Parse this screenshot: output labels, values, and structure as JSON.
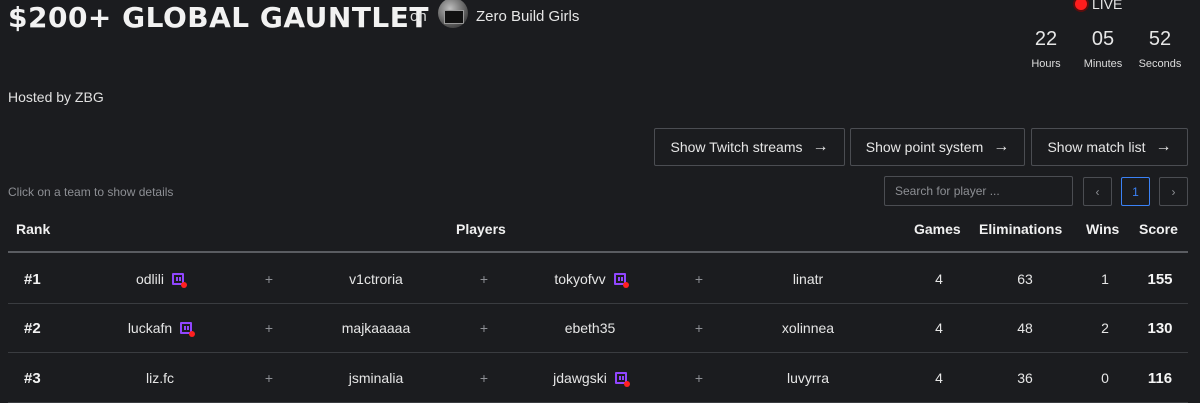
{
  "header": {
    "title": "$200+ GLOBAL GAUNTLET",
    "on_label": "on",
    "org_name": "Zero Build Girls",
    "hosted_by": "Hosted by ZBG"
  },
  "status": {
    "live_label": "LIVE",
    "live_color": "#ff1d1d"
  },
  "countdown": {
    "hours": "22",
    "hours_label": "Hours",
    "minutes": "05",
    "minutes_label": "Minutes",
    "seconds": "52",
    "seconds_label": "Seconds"
  },
  "actions": {
    "twitch_streams": "Show Twitch streams",
    "point_system": "Show point system",
    "match_list": "Show match list",
    "arrow": "→"
  },
  "table_controls": {
    "hint": "Click on a team to show details",
    "search_placeholder": "Search for player ...",
    "pagination": {
      "prev": "‹",
      "current": "1",
      "next": "›"
    }
  },
  "table": {
    "headers": {
      "rank": "Rank",
      "players": "Players",
      "games": "Games",
      "eliminations": "Eliminations",
      "wins": "Wins",
      "score": "Score"
    },
    "separator": "+",
    "rows": [
      {
        "rank": "#1",
        "players": [
          {
            "name": "odlili",
            "twitch_live": true
          },
          {
            "name": "v1ctroria",
            "twitch_live": false
          },
          {
            "name": "tokyofvv",
            "twitch_live": true
          },
          {
            "name": "linatr",
            "twitch_live": false
          }
        ],
        "games": "4",
        "eliminations": "63",
        "wins": "1",
        "score": "155"
      },
      {
        "rank": "#2",
        "players": [
          {
            "name": "luckafn",
            "twitch_live": true
          },
          {
            "name": "majkaaaaa",
            "twitch_live": false
          },
          {
            "name": "ebeth35",
            "twitch_live": false
          },
          {
            "name": "xolinnea",
            "twitch_live": false
          }
        ],
        "games": "4",
        "eliminations": "48",
        "wins": "2",
        "score": "130"
      },
      {
        "rank": "#3",
        "players": [
          {
            "name": "liz.fc",
            "twitch_live": false
          },
          {
            "name": "jsminalia",
            "twitch_live": false
          },
          {
            "name": "jdawgski",
            "twitch_live": true
          },
          {
            "name": "luvyrra",
            "twitch_live": false
          }
        ],
        "games": "4",
        "eliminations": "36",
        "wins": "0",
        "score": "116"
      }
    ]
  },
  "colors": {
    "background": "#1b1c1f",
    "accent_blue": "#3b82f6",
    "twitch_purple": "#9146ff"
  }
}
